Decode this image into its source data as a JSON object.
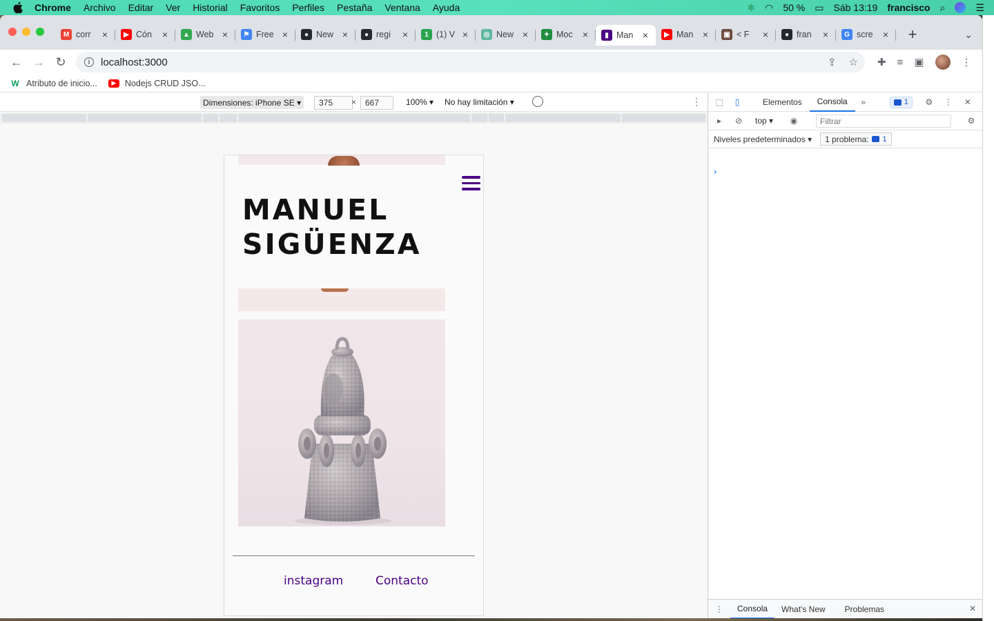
{
  "menubar": {
    "app": "Chrome",
    "items": [
      "Archivo",
      "Editar",
      "Ver",
      "Historial",
      "Favoritos",
      "Perfiles",
      "Pestaña",
      "Ventana",
      "Ayuda"
    ],
    "battery": "50 %",
    "clock": "Sáb 13:19",
    "user": "francisco"
  },
  "tabs": [
    {
      "label": "corr",
      "color": "#ea4335",
      "glyph": "M"
    },
    {
      "label": "Cón",
      "color": "#ff0000",
      "glyph": "▶"
    },
    {
      "label": "Web",
      "color": "#34a853",
      "glyph": "▲"
    },
    {
      "label": "Free",
      "color": "#4285f4",
      "glyph": "⚑"
    },
    {
      "label": "New",
      "color": "#24292f",
      "glyph": "●"
    },
    {
      "label": "regi",
      "color": "#24292f",
      "glyph": "●"
    },
    {
      "label": "(1) V",
      "color": "#2aa44f",
      "glyph": "1"
    },
    {
      "label": "New",
      "color": "#5fb8a0",
      "glyph": "◎"
    },
    {
      "label": "Moc",
      "color": "#1e8e3e",
      "glyph": "✦"
    },
    {
      "label": "Man",
      "color": "#4b0082",
      "glyph": "▮",
      "active": true
    },
    {
      "label": "Man",
      "color": "#ff0000",
      "glyph": "▶"
    },
    {
      "label": "< F",
      "color": "#6d4c41",
      "glyph": "▣"
    },
    {
      "label": "fran",
      "color": "#24292f",
      "glyph": "●"
    },
    {
      "label": "scre",
      "color": "#4285f4",
      "glyph": "G"
    }
  ],
  "address": {
    "url": "localhost:3000"
  },
  "bookmarks": [
    {
      "label": "Atributo de inicio...",
      "color": "#0f9d58",
      "glyph": "W"
    },
    {
      "label": "Nodejs CRUD JSO...",
      "color": "#ff0000",
      "glyph": "▶"
    }
  ],
  "device": {
    "dimensions_label": "Dimensiones: iPhone SE",
    "width": "375",
    "height": "667",
    "x_sep": "×",
    "zoom": "100%",
    "throttle": "No hay limitación"
  },
  "site": {
    "name_line1": "MANUEL",
    "name_line2": "SIGÜENZA",
    "footer_links": [
      "instagram",
      "Contacto"
    ]
  },
  "devtools": {
    "tabs": [
      "Elementos",
      "Consola"
    ],
    "active_tab": "Consola",
    "issues_count": "1",
    "context": "top",
    "filter_placeholder": "Filtrar",
    "levels": "Niveles predeterminados",
    "problems_label": "1 problema:",
    "problems_count": "1",
    "prompt": "›",
    "drawer_tabs": [
      "Consola",
      "What's New",
      "Problemas"
    ]
  },
  "colors": {
    "brand_purple": "#4b0082",
    "devtools_accent": "#1a73e8",
    "menubar": "#4dd9b4"
  }
}
